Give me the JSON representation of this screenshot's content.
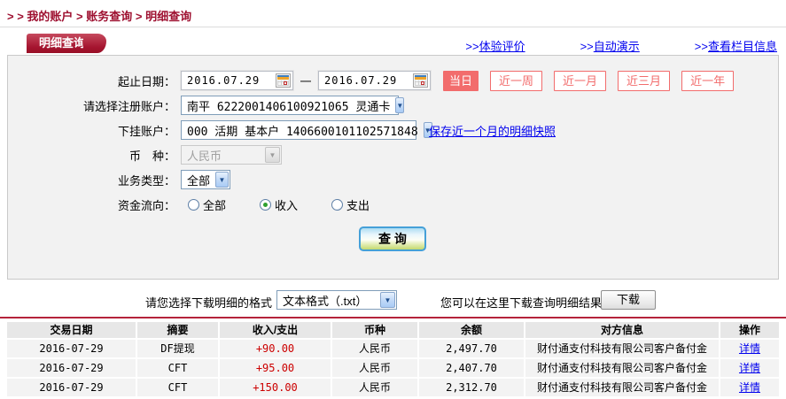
{
  "breadcrumb": {
    "prefix": "> > ",
    "separator": " > ",
    "items": [
      "我的账户",
      "账务查询",
      "明细查询"
    ]
  },
  "tab": {
    "title": "明细查询"
  },
  "header_links": [
    {
      "prefix": ">>",
      "label": "体验评价"
    },
    {
      "prefix": ">>",
      "label": "自动演示"
    },
    {
      "prefix": ">>",
      "label": "查看栏目信息"
    }
  ],
  "form": {
    "date_range": {
      "label": "起止日期：",
      "start": "2016.07.29",
      "end": "2016.07.29",
      "separator": "—"
    },
    "quick_buttons": [
      {
        "label": "当日",
        "active": true
      },
      {
        "label": "近一周",
        "active": false
      },
      {
        "label": "近一月",
        "active": false
      },
      {
        "label": "近三月",
        "active": false
      },
      {
        "label": "近一年",
        "active": false
      }
    ],
    "register_account": {
      "label": "请选择注册账户：",
      "value": "南平 6222001406100921065 灵通卡"
    },
    "sub_account": {
      "label": "下挂账户：",
      "value": "000 活期 基本户 1406600101102571848",
      "link": "保存近一个月的明细快照"
    },
    "currency": {
      "label": "币　种：",
      "value": "人民币",
      "disabled": true
    },
    "business_type": {
      "label": "业务类型：",
      "value": "全部"
    },
    "fund_flow": {
      "label": "资金流向：",
      "options": [
        {
          "label": "全部",
          "checked": false
        },
        {
          "label": "收入",
          "checked": true
        },
        {
          "label": "支出",
          "checked": false
        }
      ]
    },
    "query_button": "查 询"
  },
  "download": {
    "format_label": "请您选择下载明细的格式",
    "format_value": "文本格式（.txt）",
    "hint": "您可以在这里下载查询明细结果",
    "button": "下载"
  },
  "table": {
    "headers": [
      "交易日期",
      "摘要",
      "收入/支出",
      "币种",
      "余额",
      "对方信息",
      "操作"
    ],
    "rows": [
      [
        "2016-07-29",
        "DF提现",
        "+90.00",
        "人民币",
        "2,497.70",
        "财付通支付科技有限公司客户备付金",
        "详情"
      ],
      [
        "2016-07-29",
        "CFT",
        "+95.00",
        "人民币",
        "2,407.70",
        "财付通支付科技有限公司客户备付金",
        "详情"
      ],
      [
        "2016-07-29",
        "CFT",
        "+150.00",
        "人民币",
        "2,312.70",
        "财付通支付科技有限公司客户备付金",
        "详情"
      ]
    ]
  },
  "icons": {
    "dropdown_arrow": "▼"
  },
  "colors": {
    "brand_crimson": "#A5142F",
    "salmon_accent": "#F26C6C",
    "link_blue": "#0000EE",
    "amount_red": "#CC0000",
    "panel_bg": "#F2F2F2",
    "table_row_bg": "#F3F3F3"
  }
}
